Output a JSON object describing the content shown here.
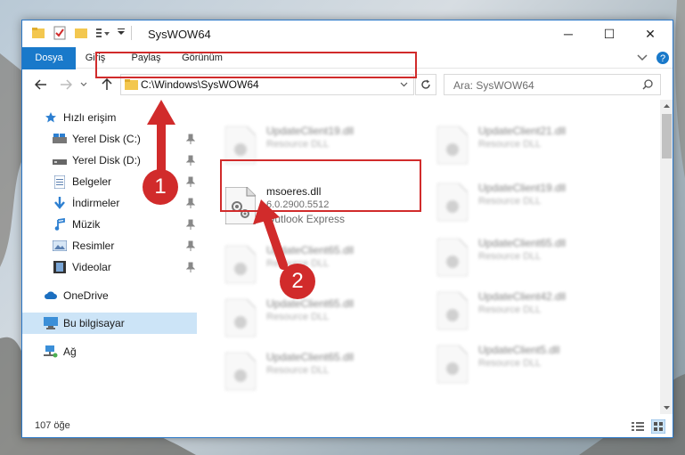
{
  "window": {
    "title": "SysWOW64",
    "controls": {
      "minimize": "─",
      "maximize": "☐",
      "close": "✕"
    }
  },
  "ribbon": {
    "tabs": [
      "Dosya",
      "Giriş",
      "Paylaş",
      "Görünüm"
    ]
  },
  "nav": {
    "address": "C:\\Windows\\SysWOW64",
    "search_placeholder": "Ara: SysWOW64"
  },
  "sidebar": {
    "items": [
      {
        "label": "Hızlı erişim",
        "icon": "star-icon"
      },
      {
        "label": "Yerel Disk (C:)",
        "icon": "drive-icon"
      },
      {
        "label": "Yerel Disk (D:)",
        "icon": "drive-icon"
      },
      {
        "label": "Belgeler",
        "icon": "documents-icon"
      },
      {
        "label": "İndirmeler",
        "icon": "download-icon"
      },
      {
        "label": "Müzik",
        "icon": "music-icon"
      },
      {
        "label": "Resimler",
        "icon": "pictures-icon"
      },
      {
        "label": "Videolar",
        "icon": "videos-icon"
      },
      {
        "label": "OneDrive",
        "icon": "cloud-icon"
      },
      {
        "label": "Bu bilgisayar",
        "icon": "computer-icon"
      },
      {
        "label": "Ağ",
        "icon": "network-icon"
      }
    ]
  },
  "files": {
    "left": [
      {
        "name": "UpdateClient19.dll",
        "type": "Resource DLL"
      },
      {
        "name": "msoeres.dll",
        "version": "6.0.2900.5512",
        "desc": "Outlook Express"
      },
      {
        "name": "UpdateClient65.dll",
        "type": "Resource DLL"
      },
      {
        "name": "UpdateClient65.dll",
        "type": "Resource DLL"
      },
      {
        "name": "UpdateClient65.dll",
        "type": "Resource DLL"
      }
    ],
    "right": [
      {
        "name": "UpdateClient21.dll",
        "type": "Resource DLL"
      },
      {
        "name": "UpdateClient19.dll",
        "type": "Resource DLL"
      },
      {
        "name": "UpdateClient65.dll",
        "type": "Resource DLL"
      },
      {
        "name": "UpdateClient42.dll",
        "type": "Resource DLL"
      },
      {
        "name": "UpdateClient5.dll",
        "type": "Resource DLL"
      }
    ]
  },
  "status": {
    "count": "107 öğe"
  },
  "annotations": {
    "marker1": "1",
    "marker2": "2"
  },
  "colors": {
    "accent": "#1979ca",
    "highlight": "#d12b2b",
    "selected": "#cce4f7"
  }
}
